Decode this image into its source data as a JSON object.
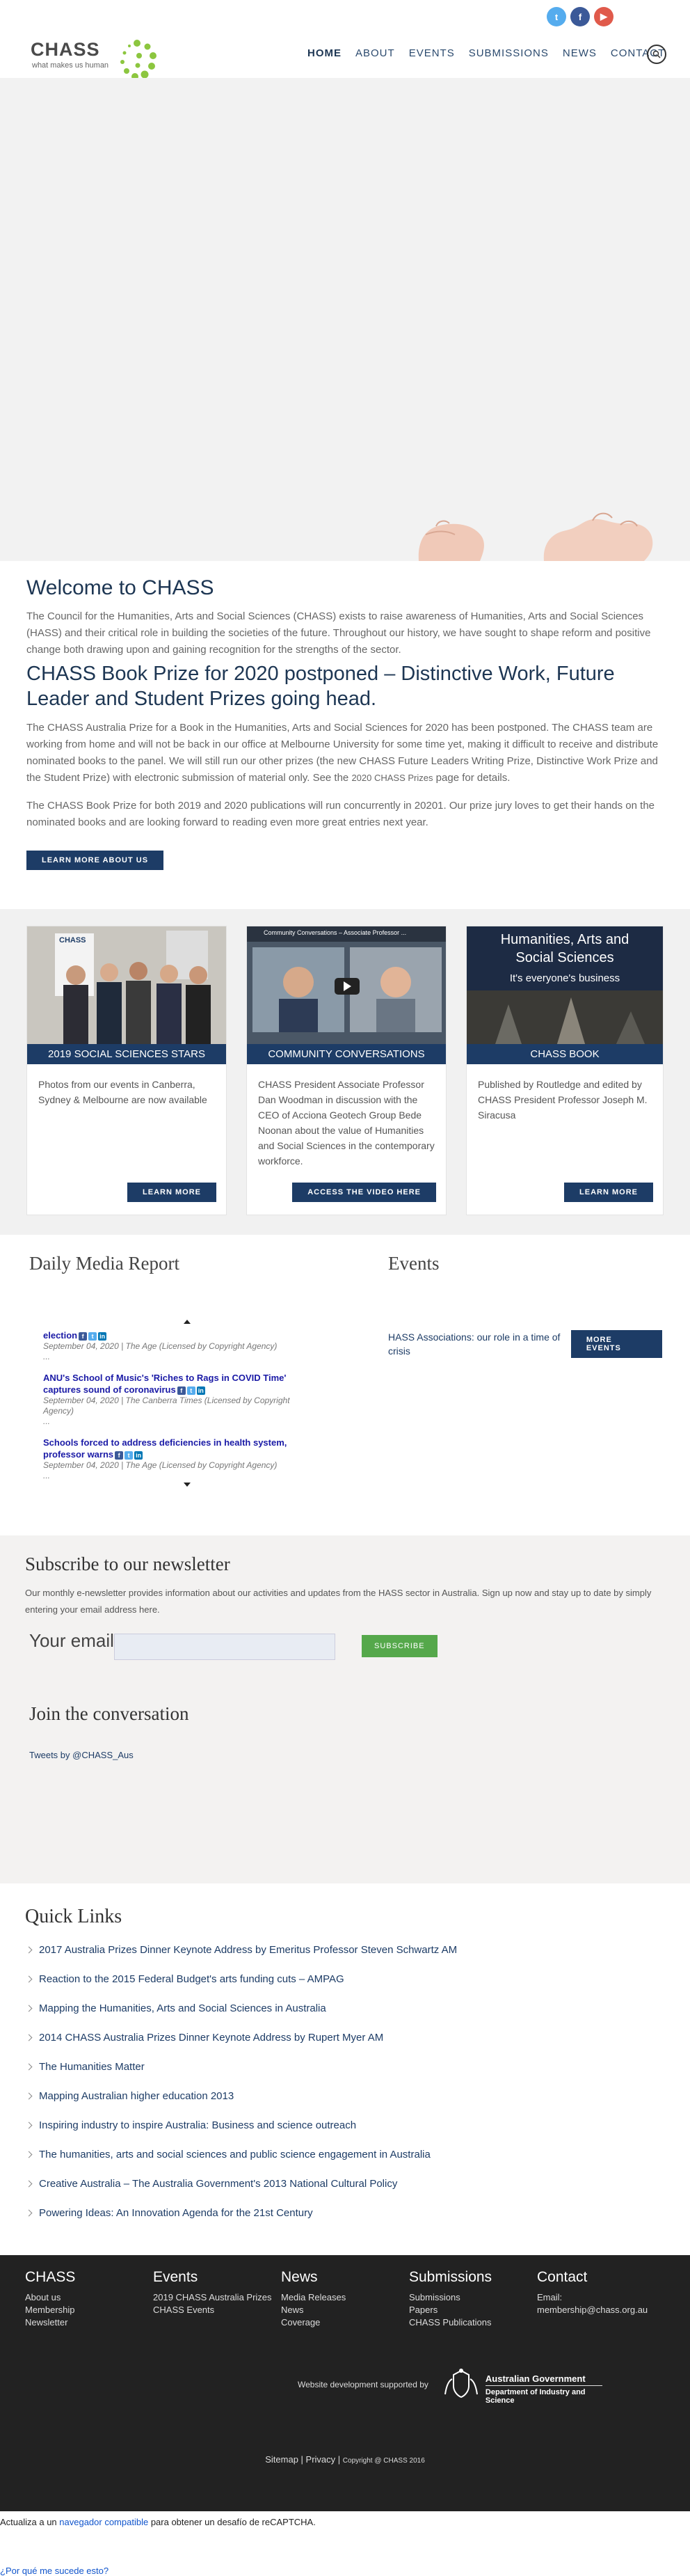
{
  "header": {
    "logo_word": "CHASS",
    "logo_tagline": "what makes us human",
    "social": [
      {
        "name": "twitter-icon",
        "glyph": "t",
        "color": "#55acee"
      },
      {
        "name": "facebook-icon",
        "glyph": "f",
        "color": "#3b5998"
      },
      {
        "name": "youtube-icon",
        "glyph": "▶",
        "color": "#e05a4b"
      }
    ],
    "nav": [
      "HOME",
      "ABOUT",
      "EVENTS",
      "SUBMISSIONS",
      "NEWS",
      "CONTACT"
    ]
  },
  "welcome": {
    "title": "Welcome to CHASS",
    "intro": "The Council for the Humanities, Arts and Social Sciences (CHASS) exists to raise awareness of Humanities, Arts and Social Sciences (HASS) and their critical role in building the societies of the future. Throughout our history, we have sought to shape reform and positive change both drawing upon and gaining recognition for the strengths of the sector.",
    "headline": "CHASS Book Prize for 2020 postponed – Distinctive Work, Future Leader and Student Prizes going head.",
    "para1": "The CHASS Australia Prize for a Book in the Humanities, Arts and Social Sciences for 2020 has been postponed. The CHASS team are working from home and will not be back in our office at Melbourne University for some time yet, making it difficult to receive and distribute nominated books to the panel. We will still run our other prizes (the new CHASS Future Leaders Writing Prize, Distinctive Work Prize and the Student Prize) with electronic submission of material only. See the",
    "para1_link": "2020 CHASS Prizes",
    "para1_end": " page for details.",
    "para2": "The CHASS Book Prize for both 2019 and 2020 publications will run concurrently in 20201. Our prize jury loves to get their hands on the nominated books and are looking forward to reading even more great entries next year.",
    "button": "LEARN MORE ABOUT US"
  },
  "cards": [
    {
      "caption": "2019 SOCIAL SCIENCES STARS",
      "text": "Photos from our events in Canberra, Sydney & Melbourne are now available",
      "button": "LEARN MORE",
      "banner": "CHASS"
    },
    {
      "caption": "COMMUNITY CONVERSATIONS",
      "text": "CHASS President Associate Professor Dan Woodman in discussion with the CEO of Acciona Geotech Group Bede Noonan about the value of Humanities and Social Sciences in the contemporary workforce.",
      "button": "ACCESS THE VIDEO HERE",
      "video_title": "Community Conversations – Associate Professor ..."
    },
    {
      "caption": "CHASS BOOK",
      "text": "Published by Routledge and edited by CHASS President Professor Joseph M. Siracusa",
      "button": "LEARN MORE",
      "cover_title": "Humanities, Arts and Social Sciences",
      "cover_sub": "It's everyone's business"
    }
  ],
  "media": {
    "title": "Daily Media Report",
    "items": [
      {
        "title": "election",
        "meta": "September 04, 2020 | The Age (Licensed by Copyright Agency)",
        "dots": "..."
      },
      {
        "title": "ANU's School of Music's 'Riches to Rags in COVID Time' captures sound of coronavirus",
        "meta": "September 04, 2020 | The Canberra Times (Licensed by Copyright Agency)",
        "dots": "..."
      },
      {
        "title": "Schools forced to address deficiencies in health system, professor warns",
        "meta": "September 04, 2020 | The Age (Licensed by Copyright Agency)",
        "dots": "..."
      }
    ]
  },
  "events": {
    "title": "Events",
    "item": "HASS Associations: our role in a time of crisis",
    "button": "MORE EVENTS"
  },
  "subscribe": {
    "title": "Subscribe to our newsletter",
    "text": "Our monthly e-newsletter provides information about our activities and updates from the HASS sector in Australia. Sign up now and stay up to date by simply entering your email address here.",
    "label": "Your email",
    "placeholder": "",
    "button": "SUBSCRIBE",
    "join_title": "Join the conversation",
    "tweets": "Tweets by @CHASS_Aus"
  },
  "quick": {
    "title": "Quick Links",
    "links": [
      "2017 Australia Prizes Dinner Keynote Address by Emeritus Professor Steven Schwartz AM",
      "Reaction to the 2015 Federal Budget's arts funding cuts – AMPAG",
      "Mapping the Humanities, Arts and Social Sciences in Australia",
      "2014 CHASS Australia Prizes Dinner Keynote Address by Rupert Myer AM",
      "The Humanities Matter",
      "Mapping Australian higher education 2013",
      "Inspiring industry to inspire Australia: Business and science outreach",
      "The humanities, arts and social sciences and public science engagement in Australia",
      "Creative Australia – The Australia Government's 2013 National Cultural Policy",
      "Powering Ideas: An Innovation Agenda for the 21st Century"
    ]
  },
  "footer": {
    "cols": [
      {
        "title": "CHASS",
        "links": [
          "About us",
          "Membership",
          "Newsletter"
        ]
      },
      {
        "title": "Events",
        "links": [
          "2019 CHASS Australia Prizes",
          "CHASS Events"
        ]
      },
      {
        "title": "News",
        "links": [
          "Media Releases",
          "News",
          "Coverage"
        ]
      },
      {
        "title": "Submissions",
        "links": [
          "Submissions",
          "Papers",
          "CHASS Publications"
        ]
      },
      {
        "title": "Contact",
        "links": [
          "Email:",
          "membership@chass.org.au"
        ]
      }
    ],
    "supported": "Website development supported by",
    "gov1": "Australian Government",
    "gov2": "Department of Industry and Science",
    "sitemap": "Sitemap",
    "privacy": "Privacy",
    "copyright": "Copyright @ CHASS 2016"
  },
  "recaptcha": {
    "line1a": "Actualiza a un ",
    "line1link": "navegador compatible",
    "line1b": " para obtener un desafío de reCAPTCHA.",
    "line2": "¿Por qué me sucede esto?"
  }
}
